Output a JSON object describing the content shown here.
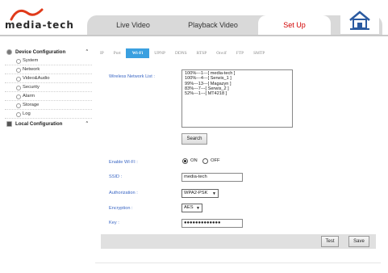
{
  "brand": {
    "logo_text": "media-tech"
  },
  "nav": {
    "tabs": [
      {
        "label": "Live Video"
      },
      {
        "label": "Playback Video"
      },
      {
        "label": "Set Up"
      }
    ],
    "home_icon": "home-icon"
  },
  "sidebar": {
    "device_config": {
      "label": "Device Configuration",
      "items": [
        "System",
        "Network",
        "Video&Audio",
        "Security",
        "Alarm",
        "Storage",
        "Log"
      ]
    },
    "local_config": {
      "label": "Local Configuration"
    }
  },
  "subtabs": [
    "IP",
    "Port",
    "Wi-Fi",
    "UPNP",
    "DDNS",
    "RTSP",
    "Onvif",
    "FTP",
    "SMTP"
  ],
  "active_subtab": "Wi-Fi",
  "wifi": {
    "list_label": "Wireless Network List :",
    "networks": [
      "100%---1---[ media-tech ]",
      "100%---4---[ Serwis_1 ]",
      "99%---13---[ Magazyn ]",
      "83%---7---[ Serwis_2 ]",
      "52%---1---[ MT4218 ]"
    ],
    "search_label": "Search",
    "enable_label": "Enable WI-FI :",
    "enable_on": "ON",
    "enable_off": "OFF",
    "enable_value": "ON",
    "ssid_label": "SSID :",
    "ssid_value": "media-tech",
    "auth_label": "Authorization :",
    "auth_value": "WPA2-PSK",
    "enc_label": "Encryption :",
    "enc_value": "AES",
    "key_label": "Key :",
    "key_value": "●●●●●●●●●●●●●",
    "test_label": "Test",
    "save_label": "Save"
  },
  "colors": {
    "accent": "#3aa0e0",
    "active_tab_text": "#d10000",
    "label_blue": "#3a66c4"
  }
}
